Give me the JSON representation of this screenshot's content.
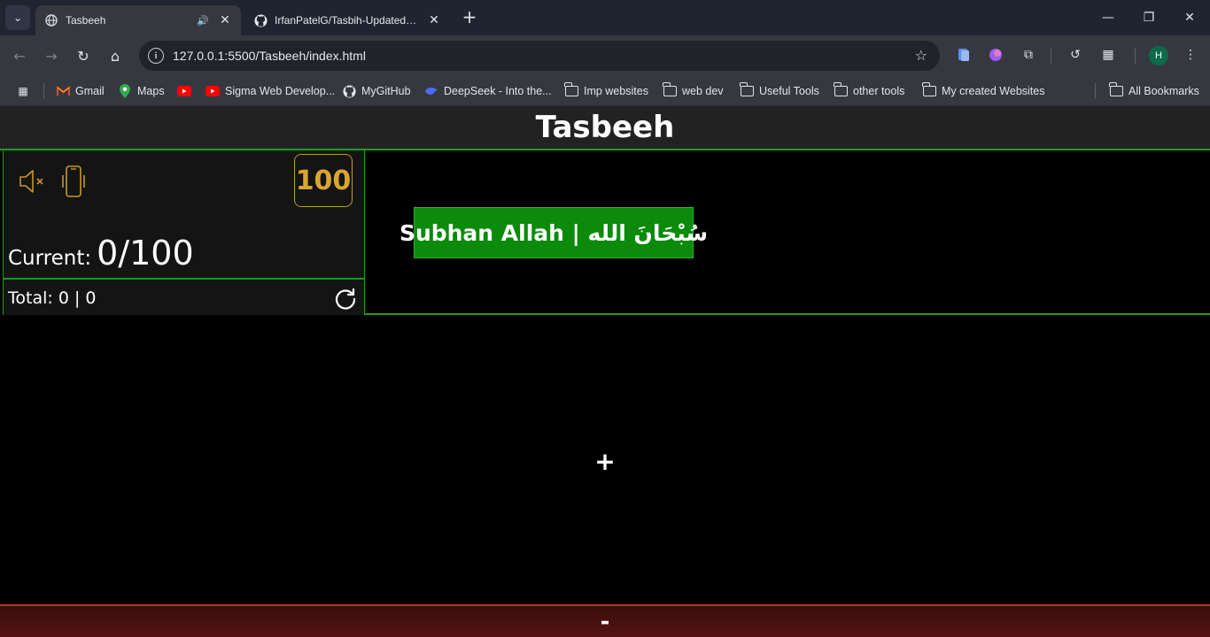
{
  "browser": {
    "tabs": [
      {
        "title": "Tasbeeh",
        "active": true
      },
      {
        "title": "IrfanPatelG/Tasbih-Updated: M",
        "active": false
      }
    ],
    "url": "127.0.0.1:5500/Tasbeeh/index.html",
    "profile_initial": "H",
    "bookmarks": [
      {
        "label": "Gmail",
        "icon": "gmail-icon"
      },
      {
        "label": "Maps",
        "icon": "maps-icon"
      },
      {
        "label": "",
        "icon": "youtube-icon"
      },
      {
        "label": "Sigma Web Develop...",
        "icon": "youtube-icon"
      },
      {
        "label": "MyGitHub",
        "icon": "github-icon"
      },
      {
        "label": "DeepSeek - Into the...",
        "icon": "deepseek-icon"
      },
      {
        "label": "Imp websites",
        "icon": "folder-icon"
      },
      {
        "label": "web dev",
        "icon": "folder-icon"
      },
      {
        "label": "Useful Tools",
        "icon": "folder-icon"
      },
      {
        "label": "other tools",
        "icon": "folder-icon"
      },
      {
        "label": "My created Websites",
        "icon": "folder-icon"
      }
    ],
    "all_bookmarks": "All Bookmarks"
  },
  "app": {
    "title": "Tasbeeh",
    "target": "100",
    "current_label": "Current:",
    "current_value": "0/100",
    "total_label": "Total: 0 | 0",
    "dhikr_label": "Subhan Allah | سُبْحَانَ الله",
    "plus": "+",
    "minus": "-"
  },
  "colors": {
    "accent_green": "#1f9a1f",
    "button_green": "#0b8a0b",
    "gold": "#d9a531",
    "minus_red": "#c42a2a"
  }
}
